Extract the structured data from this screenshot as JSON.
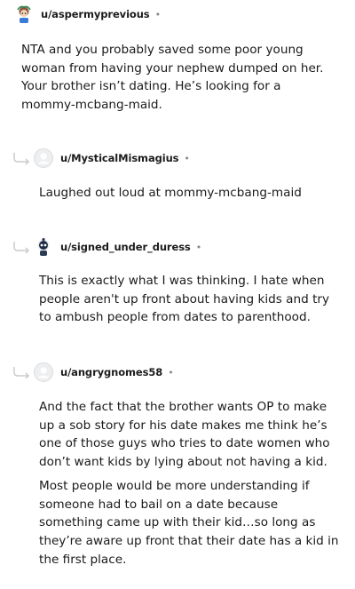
{
  "comments": [
    {
      "username": "u/aspermyprevious",
      "separator": "•",
      "paragraphs": [
        "NTA and you probably saved some poor young woman from having your nephew dumped on her. Your brother isn’t dating. He’s looking for a mommy-mcbang-maid."
      ]
    },
    {
      "username": "u/MysticalMismagius",
      "separator": "•",
      "paragraphs": [
        "Laughed out loud at mommy-mcbang-maid"
      ]
    },
    {
      "username": "u/signed_under_duress",
      "separator": "•",
      "paragraphs": [
        "This is exactly what I was thinking. I hate when people aren't up front about having kids and try to ambush people from dates to parenthood."
      ]
    },
    {
      "username": "u/angrygnomes58",
      "separator": "•",
      "paragraphs": [
        "And the fact that the brother wants OP to make up a sob story for his date makes me think he’s one of those guys who tries to date women who don’t want kids by lying about not having a kid.",
        "Most people would be more understanding if someone had to bail on a date because something came up with their kid…so long as they’re aware up front that their date has a kid in the first place."
      ]
    }
  ],
  "colors": {
    "text": "#1a1a1b",
    "meta": "#878a8c",
    "reply_line": "#c8cbcd"
  },
  "icons": {
    "reply": "reply-arrow-icon",
    "avatar_default": "default-avatar-icon",
    "avatar_custom": "snoo-avatar-icon"
  }
}
